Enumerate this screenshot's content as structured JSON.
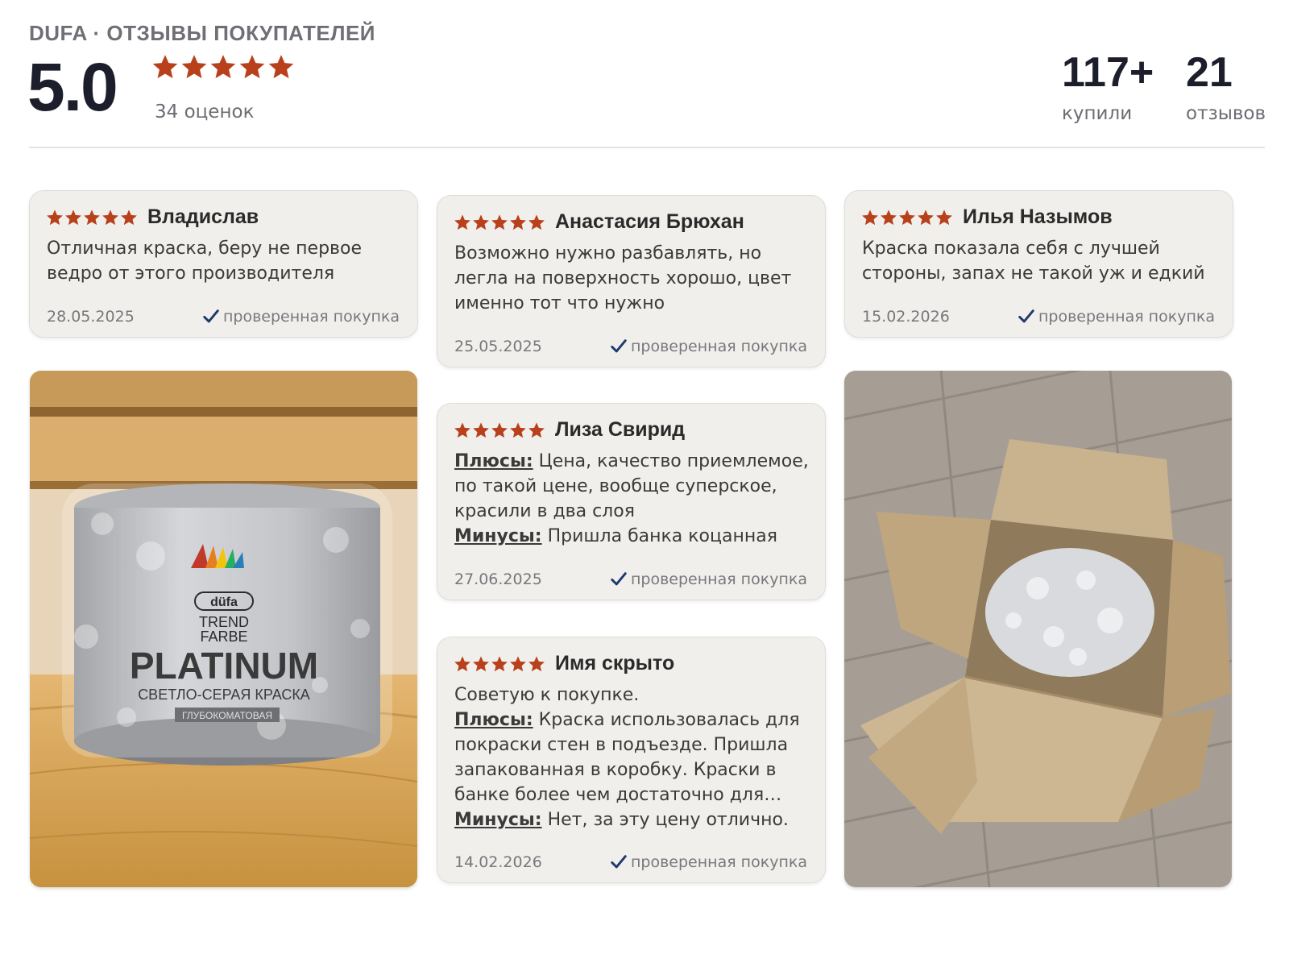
{
  "header": {
    "brand": "DUFA · ОТЗЫВЫ ПОКУПАТЕЛЕЙ",
    "rating": "5.0",
    "rating_count": "34 оценок",
    "bought_value": "117+",
    "bought_label": "купили",
    "reviews_value": "21",
    "reviews_label": "отзывов",
    "stars": 5
  },
  "colors": {
    "star": "#b8411c",
    "check": "#1f3a6e",
    "card_bg": "#f1efec"
  },
  "reviews": [
    {
      "author": "Владислав",
      "stars": 5,
      "text": "Отличная краска, беру не первое ведро от этого производителя",
      "date": "28.05.2025",
      "verified": "проверенная покупка"
    },
    {
      "author": "Анастасия Брюхан",
      "stars": 5,
      "text": "Возможно нужно разбавлять, но легла на поверхность хорошо, цвет именно тот что нужно",
      "date": "25.05.2025",
      "verified": "проверенная покупка"
    },
    {
      "author": "Илья Назымов",
      "stars": 5,
      "text": "Краска показала себя с лучшей стороны, запах не такой уж и едкий",
      "date": "15.02.2026",
      "verified": "проверенная покупка"
    },
    {
      "author": "Лиза Свирид",
      "stars": 5,
      "pros_label": "Плюсы:",
      "pros": "Цена, качество приемлемое, по такой цене, вообще суперское, красили в два слоя",
      "cons_label": "Минусы:",
      "cons": "Пришла банка коцанная",
      "date": "27.06.2025",
      "verified": "проверенная покупка"
    },
    {
      "author": "Имя скрыто",
      "stars": 5,
      "text": "Советую к покупке.",
      "pros_label": "Плюсы:",
      "pros": "Краска использовалась для покраски стен в подъезде. Пришла запакованная в коробку. Краски в банке более чем достаточно для…",
      "cons_label": "Минусы:",
      "cons": "Нет, за эту цену отлично.",
      "date": "14.02.2026",
      "verified": "проверенная покупка"
    }
  ],
  "photos": {
    "can": {
      "logo": "düfa",
      "line1": "TREND",
      "line2": "FARBE",
      "name": "PLATINUM",
      "subtitle": "СВЕТЛО-СЕРАЯ КРАСКА",
      "finish": "ГЛУБОКОМАТОВАЯ"
    }
  }
}
